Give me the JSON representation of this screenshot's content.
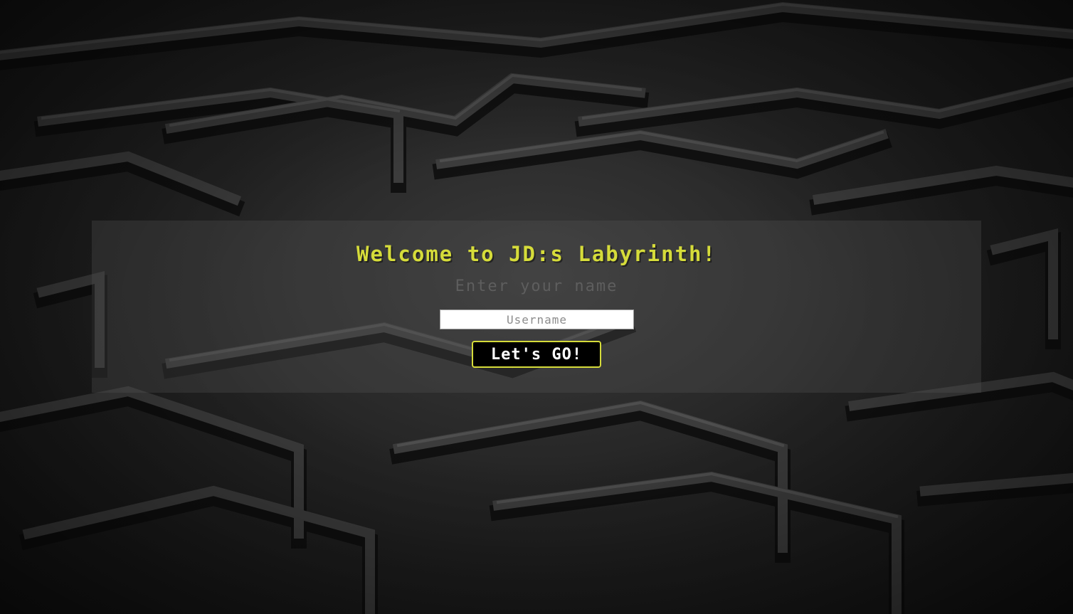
{
  "login": {
    "title": "Welcome to JD:s Labyrinth!",
    "prompt": "Enter your name",
    "username_placeholder": "Username",
    "username_value": "",
    "submit_label": "Let's GO!"
  },
  "theme": {
    "accent": "#d6dc3a",
    "prompt_color": "#5e5e5e",
    "background": "#1a1a1a"
  }
}
